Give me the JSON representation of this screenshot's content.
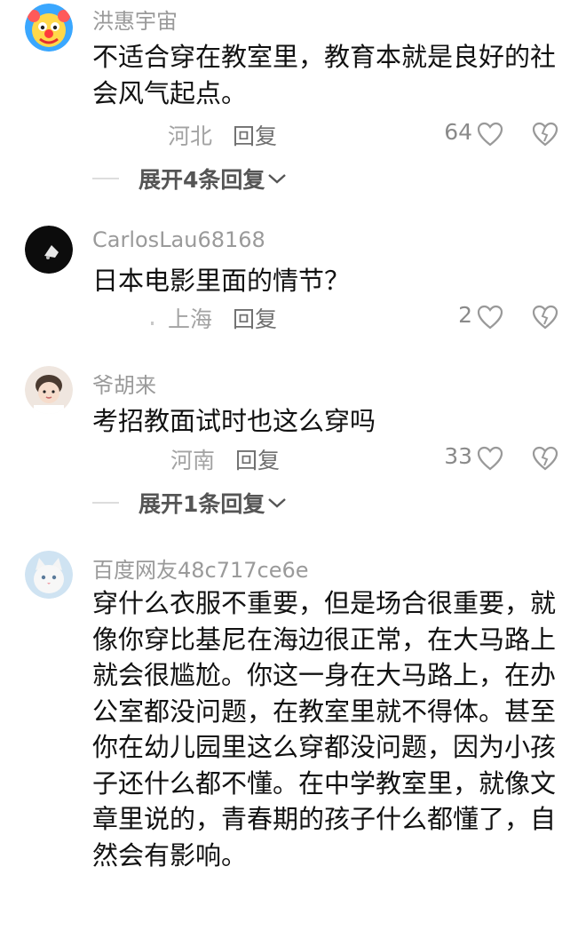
{
  "comments": [
    {
      "username": "洪惠宇宙",
      "avatar": "clown-avatar",
      "text": "不适合穿在教室里，教育本就是良好的社会风气起点。",
      "location": "河北",
      "reply_label": "回复",
      "likes": "64",
      "expand_label": "展开4条回复"
    },
    {
      "username": "CarlosLau68168",
      "avatar": "dark-avatar",
      "text": "日本电影里面的情节？",
      "location": "上海",
      "reply_label": "回复",
      "likes": "2"
    },
    {
      "username": "爷胡来",
      "avatar": "child-avatar",
      "text": "考招教面试时也这么穿吗",
      "location": "河南",
      "reply_label": "回复",
      "likes": "33",
      "expand_label": "展开1条回复"
    },
    {
      "username": "百度网友48c717ce6e",
      "avatar": "cat-avatar",
      "text": "穿什么衣服不重要，但是场合很重要，就像你穿比基尼在海边很正常，在大马路上就会很尴尬。你这一身在大马路上，在办公室都没问题，在教室里就不得体。甚至你在幼儿园里这么穿都没问题，因为小孩子还什么都不懂。在中学教室里，就像文章里说的，青春期的孩子什么都懂了，自然会有影响。"
    }
  ],
  "colors": {
    "username": "#9a9a9a",
    "text": "#111111",
    "meta": "#a3a3a3",
    "icon": "#999999"
  }
}
